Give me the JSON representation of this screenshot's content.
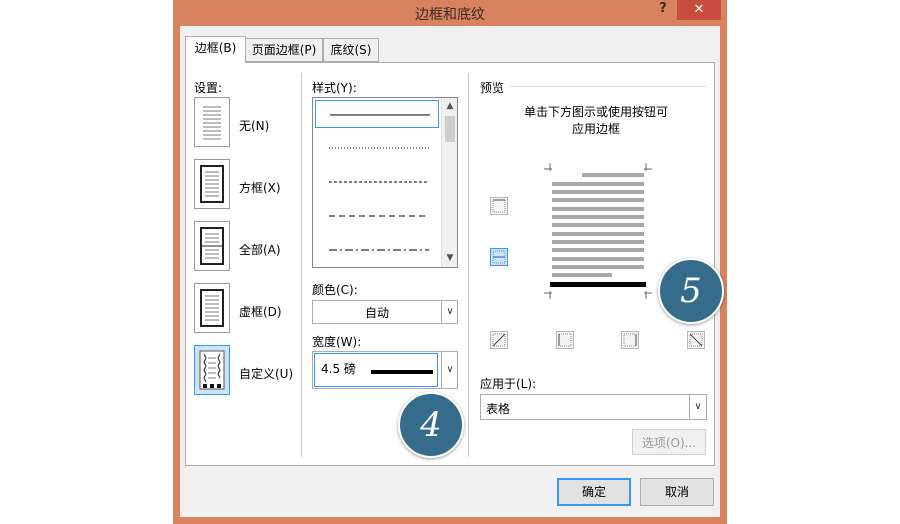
{
  "window": {
    "title": "边框和底纹",
    "help_label": "?",
    "close_label": "✕"
  },
  "tabs": [
    {
      "label": "边框(B)"
    },
    {
      "label": "页面边框(P)"
    },
    {
      "label": "底纹(S)"
    }
  ],
  "settings": {
    "label": "设置:",
    "options": [
      {
        "label": "无(N)"
      },
      {
        "label": "方框(X)"
      },
      {
        "label": "全部(A)"
      },
      {
        "label": "虚框(D)"
      },
      {
        "label": "自定义(U)"
      }
    ],
    "selected": "自定义(U)"
  },
  "style": {
    "label": "样式(Y):",
    "options": [
      "solid",
      "dotted",
      "dashed-fine",
      "dashed",
      "dash-dot"
    ],
    "selected": "solid"
  },
  "color": {
    "label": "颜色(C):",
    "value": "自动"
  },
  "width": {
    "label": "宽度(W):",
    "value": "4.5 磅"
  },
  "preview": {
    "label": "预览",
    "hint_line1": "单击下方图示或使用按钮可",
    "hint_line2": "应用边框"
  },
  "apply_to": {
    "label": "应用于(L):",
    "value": "表格"
  },
  "buttons": {
    "options": "选项(O)...",
    "ok": "确定",
    "cancel": "取消"
  },
  "annotations": {
    "step4": "4",
    "step5": "5"
  },
  "colors": {
    "title_bar": "#d8825f",
    "close_button": "#c94c3e",
    "badge": "#356c8b",
    "selection": "#3399ff"
  }
}
